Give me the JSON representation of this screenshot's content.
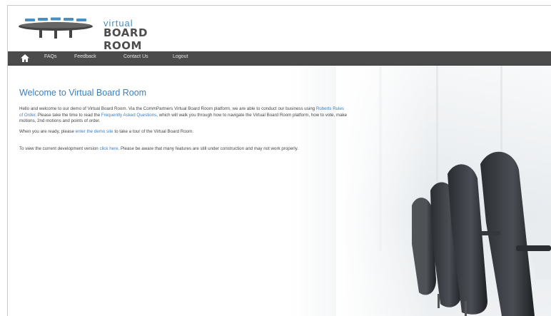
{
  "brand": {
    "small": "virtual",
    "big": "BOARD ROOM"
  },
  "nav": {
    "home_icon": "home-icon",
    "items": [
      "FAQs",
      "Feedback",
      "Contact Us",
      "Logout"
    ]
  },
  "welcome": {
    "title": "Welcome to Virtual Board Room",
    "p1_a": "Hello and welcome to our demo of Virtual Board Room. Via the CommPartners Virtual Board Room platform, we are able to conduct our business using ",
    "p1_link1": "Roberts Rules of Order",
    "p1_b": ". Please take the time to read the ",
    "p1_link2": "Frequently Asked Questions",
    "p1_c": ", which will walk you through how to navigate the Virtual Board Room platform, how to vote, make motions, 2nd motions and points of order.",
    "p2_a": "When you are ready, please ",
    "p2_link": "enter the demo site",
    "p2_b": " to take a tour of the Virtual Board Room.",
    "p3_a": "To view the current development version ",
    "p3_link": "click here",
    "p3_b": ". Please be aware that many features are still under construction and may not work properly."
  },
  "colors": {
    "accent": "#3b7ec2",
    "nav_bg": "#4b4b4b",
    "logo_blue": "#4a8fc0"
  }
}
